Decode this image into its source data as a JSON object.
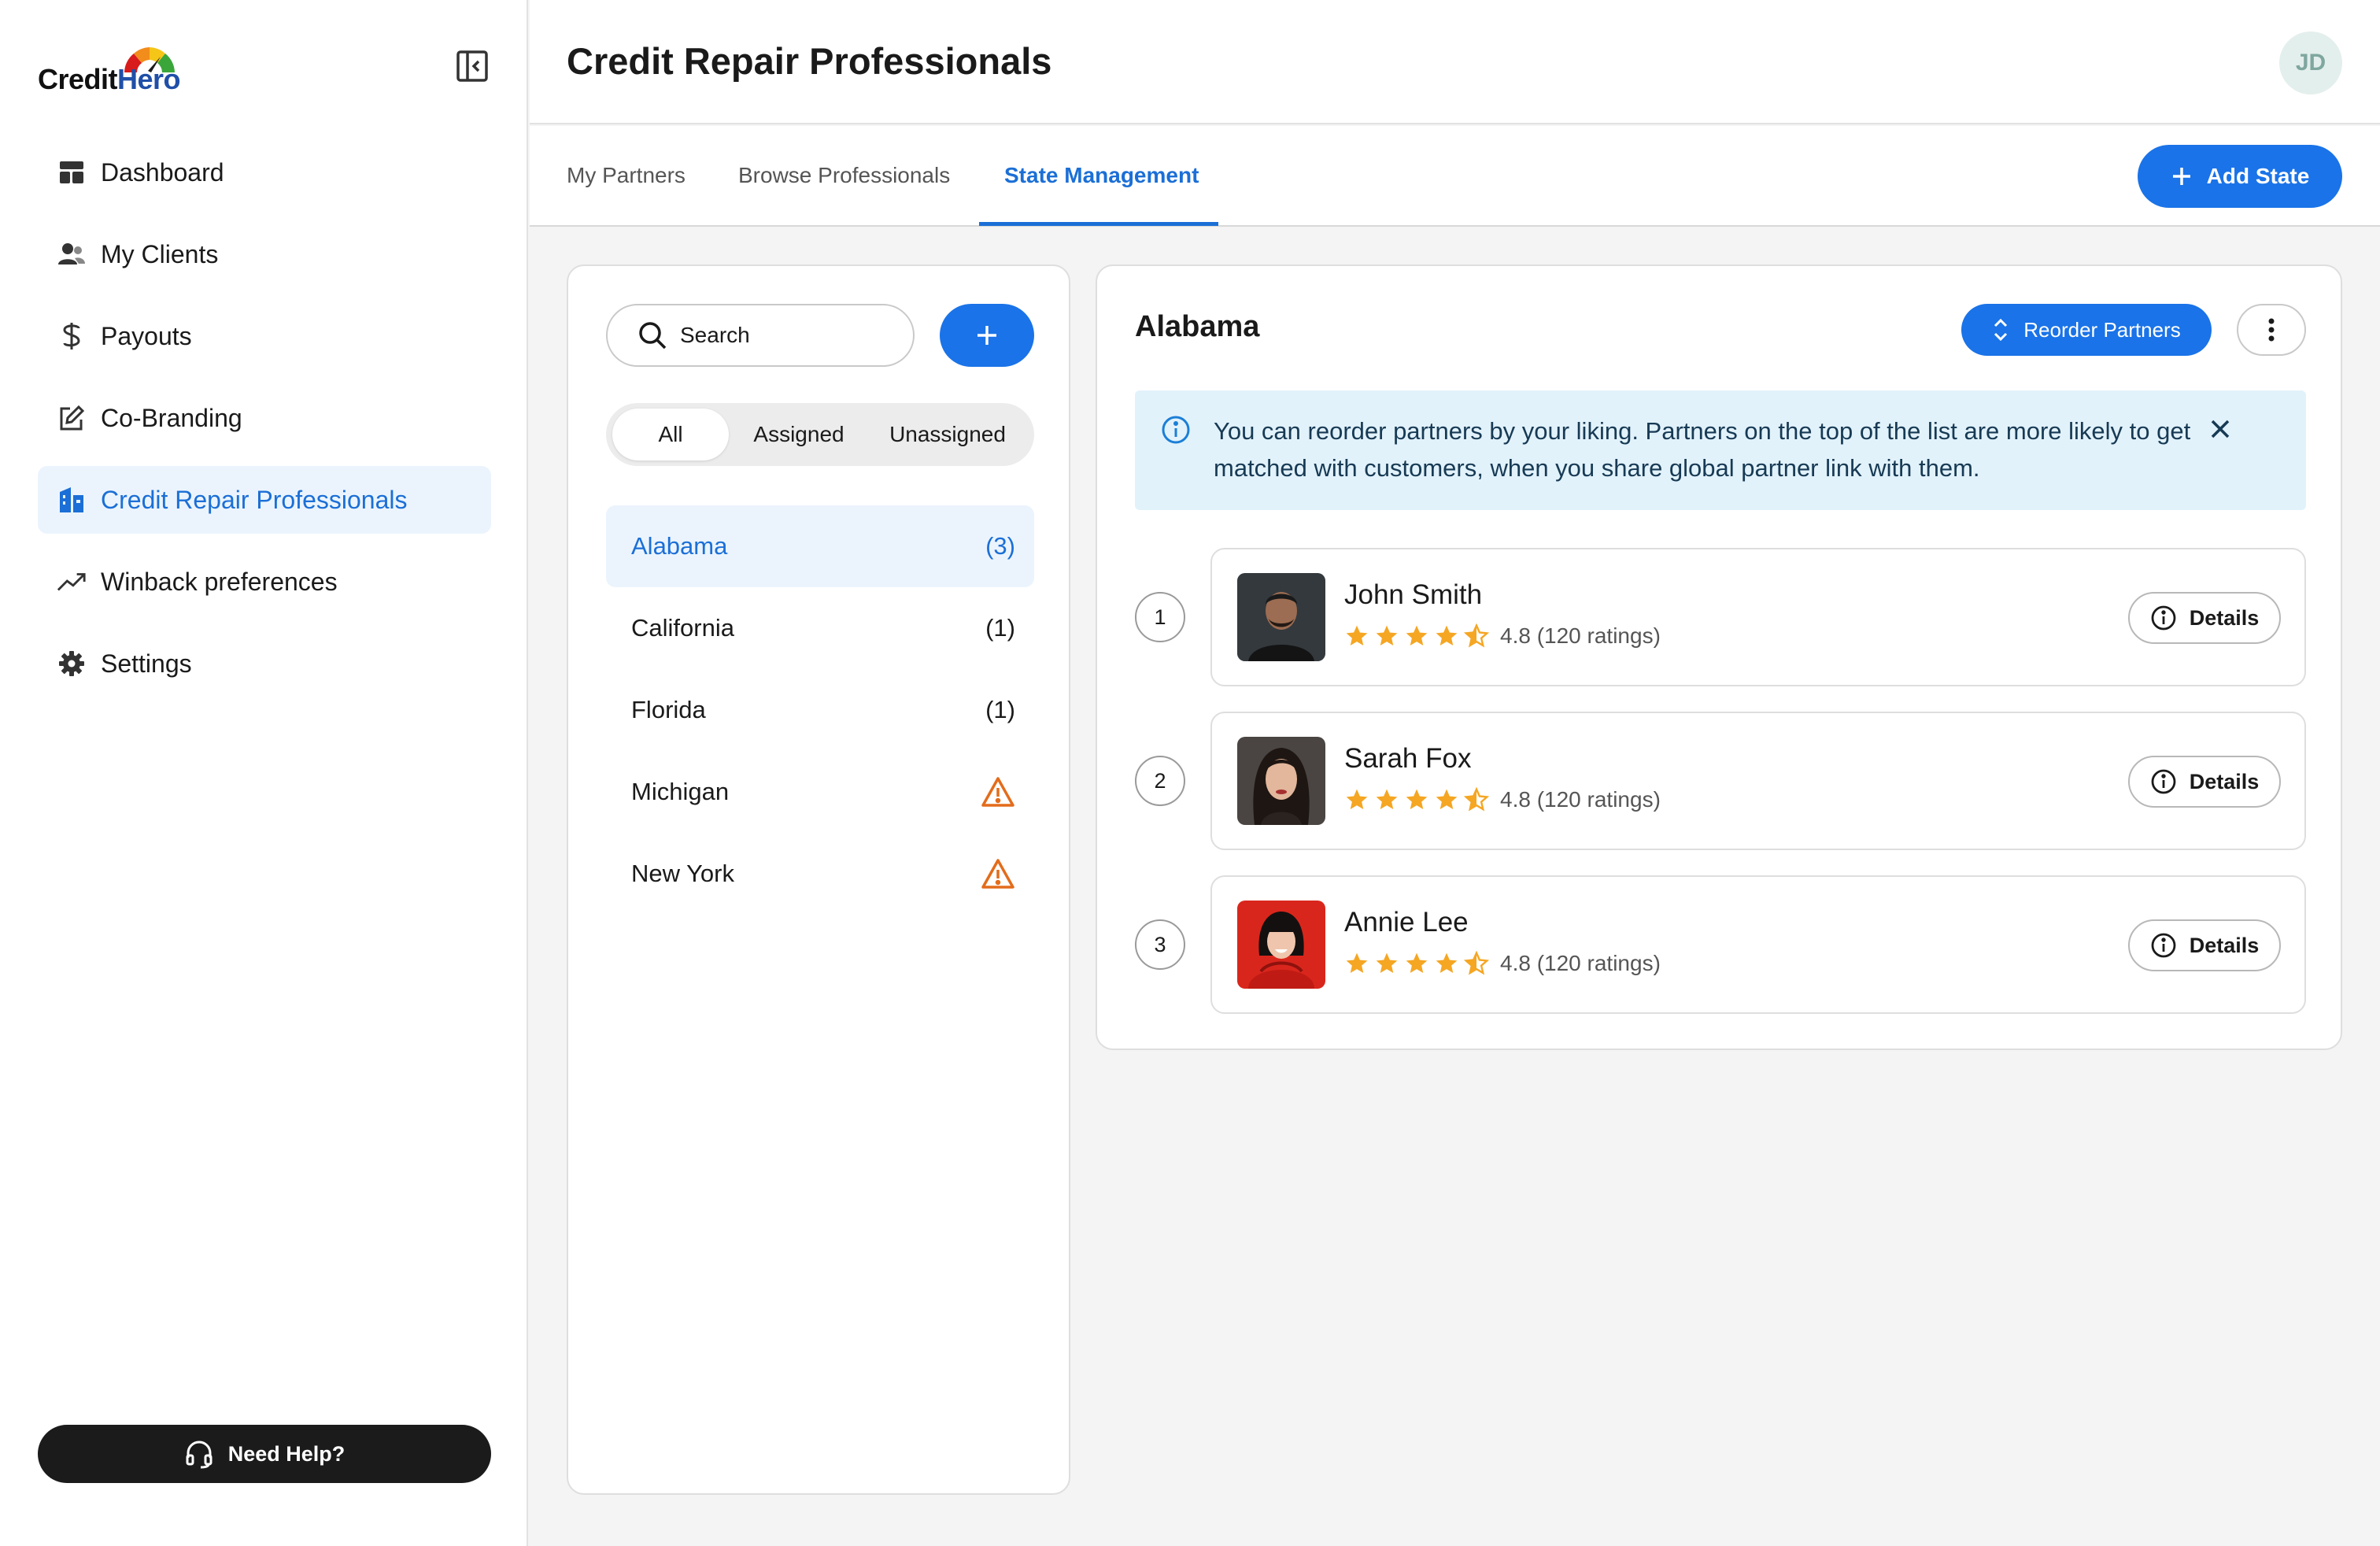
{
  "brand": {
    "logo_prefix": "Credit",
    "logo_suffix": "Hero",
    "colors": {
      "primary": "#1a73e8",
      "active_bg": "#ebf4fd",
      "warning": "#e36c1b",
      "star": "#f5a623",
      "info_bg": "#e2f2fb"
    }
  },
  "sidebar": {
    "items": [
      {
        "label": "Dashboard",
        "icon": "dashboard-icon"
      },
      {
        "label": "My Clients",
        "icon": "users-icon"
      },
      {
        "label": "Payouts",
        "icon": "dollar-icon"
      },
      {
        "label": "Co-Branding",
        "icon": "edit-icon"
      },
      {
        "label": "Credit Repair Professionals",
        "icon": "building-icon",
        "active": true
      },
      {
        "label": "Winback preferences",
        "icon": "trending-up-icon"
      },
      {
        "label": "Settings",
        "icon": "gear-icon"
      }
    ],
    "help_label": "Need Help?"
  },
  "header": {
    "title": "Credit Repair Professionals",
    "user_initials": "JD"
  },
  "tabs": {
    "items": [
      {
        "label": "My Partners"
      },
      {
        "label": "Browse Professionals"
      },
      {
        "label": "State Management",
        "active": true
      }
    ],
    "add_state_label": "Add State"
  },
  "states_panel": {
    "search_placeholder": "Search",
    "filters": [
      {
        "label": "All",
        "active": true
      },
      {
        "label": "Assigned"
      },
      {
        "label": "Unassigned"
      }
    ],
    "states": [
      {
        "name": "Alabama",
        "count": "(3)",
        "active": true
      },
      {
        "name": "California",
        "count": "(1)"
      },
      {
        "name": "Florida",
        "count": "(1)"
      },
      {
        "name": "Michigan",
        "warning": true
      },
      {
        "name": "New York",
        "warning": true
      }
    ]
  },
  "detail": {
    "title": "Alabama",
    "reorder_label": "Reorder Partners",
    "info_text": "You can reorder partners by your liking. Partners on the top of the list are more likely to get matched with customers, when you share global partner link with them.",
    "details_label": "Details",
    "partners": [
      {
        "rank": "1",
        "name": "John Smith",
        "rating": 4.8,
        "rating_text": "4.8 (120 ratings)"
      },
      {
        "rank": "2",
        "name": "Sarah Fox",
        "rating": 4.8,
        "rating_text": "4.8 (120 ratings)"
      },
      {
        "rank": "3",
        "name": "Annie Lee",
        "rating": 4.8,
        "rating_text": "4.8 (120 ratings)"
      }
    ]
  }
}
